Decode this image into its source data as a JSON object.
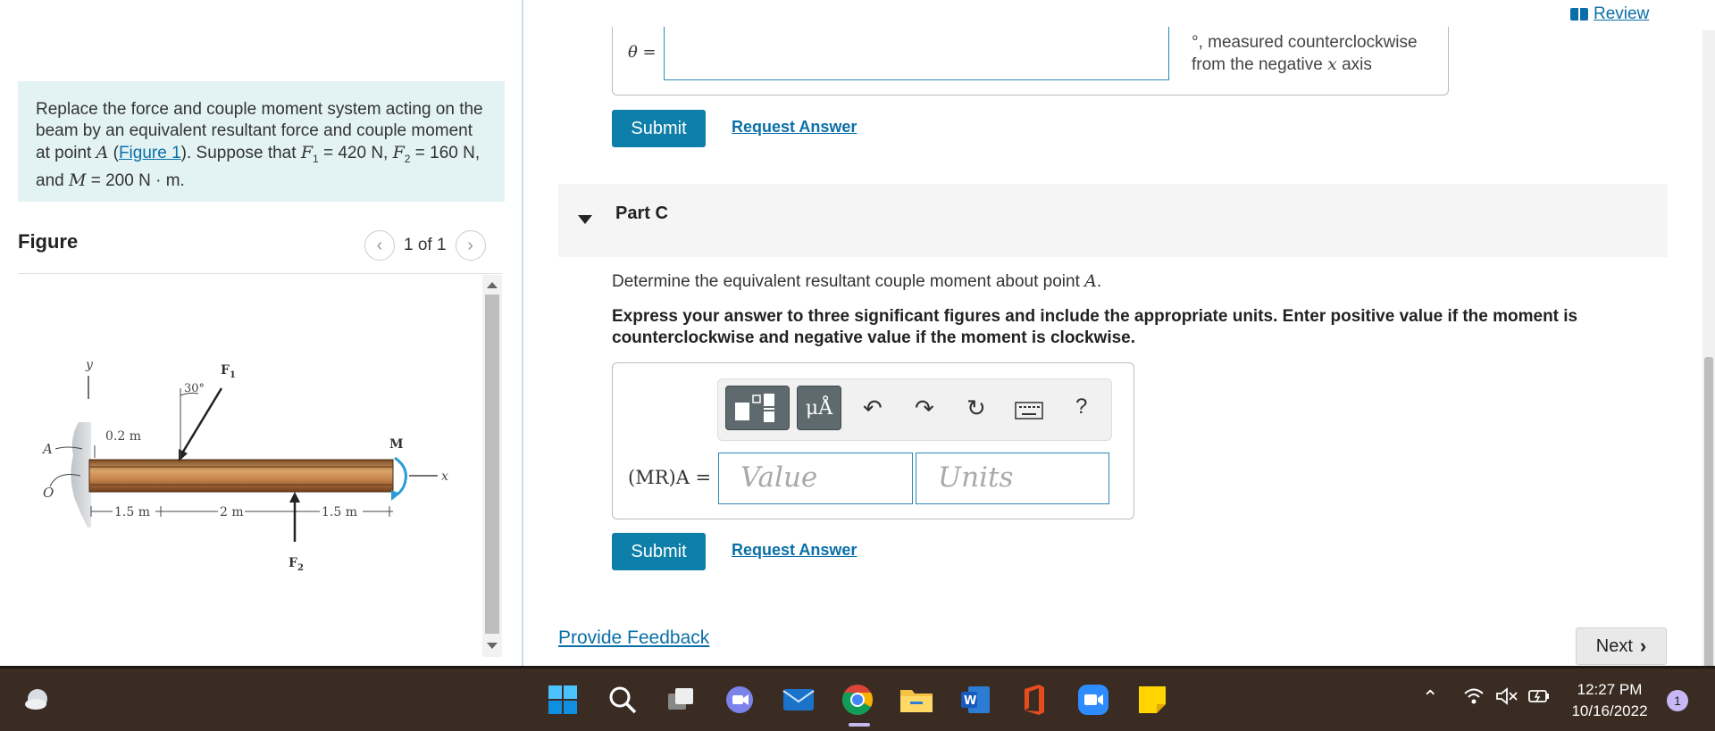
{
  "problem": {
    "text_part1": "Replace the force and couple moment system acting on the beam by an equivalent resultant force and couple moment at point ",
    "point": "A",
    "paren_open": " (",
    "figure_link": "Figure 1",
    "text_part2": "). Suppose that ",
    "f1_var": "F",
    "f1_sub": "1",
    "f1_value": " = 420 N,",
    "f2_var": "F",
    "f2_sub": "2",
    "f2_value": " = 160 N, and ",
    "m_var": "M",
    "m_value": " = 200 N · m."
  },
  "figure": {
    "title": "Figure",
    "pager": "1 of 1",
    "labels": {
      "y": "y",
      "F1": "F",
      "F1_sub": "1",
      "angle": "30°",
      "dim_02": "0.2 m",
      "A": "A",
      "M": "M",
      "x": "x",
      "O": "O",
      "dim_15a": "1.5 m",
      "dim_2": "2 m",
      "dim_15b": "1.5 m",
      "F2": "F",
      "F2_sub": "2"
    }
  },
  "part_b": {
    "theta_label": "θ =",
    "theta_note_line1": "°, measured counterclockwise",
    "theta_note_line2a": "from the negative ",
    "theta_note_var": "x",
    "theta_note_line2b": " axis",
    "submit": "Submit",
    "request": "Request Answer"
  },
  "part_c": {
    "label": "Part C",
    "question_pre": "Determine the equivalent resultant couple moment about point ",
    "question_var": "A",
    "question_post": ".",
    "instruction": "Express your answer to three significant figures and include the appropriate units. Enter positive value if the moment is counterclockwise and negative value if the moment is clockwise.",
    "toolbar_units": "μÅ",
    "help": "?",
    "answer_label": "(MR)A =",
    "value_placeholder": "Value",
    "units_placeholder": "Units",
    "submit": "Submit",
    "request": "Request Answer"
  },
  "footer": {
    "feedback": "Provide Feedback",
    "next": "Next"
  },
  "header": {
    "review": "Review"
  },
  "taskbar": {
    "time": "12:27 PM",
    "date": "10/16/2022",
    "notifications": "1",
    "apps": [
      "start-icon",
      "search-icon",
      "task-view-icon",
      "teams-chat-icon",
      "mail-icon",
      "chrome-icon",
      "file-explorer-icon",
      "word-icon",
      "office-icon",
      "zoom-icon",
      "sticky-notes-icon"
    ],
    "word_letter": "W"
  },
  "colors": {
    "accent": "#0e7fa9",
    "link": "#0a6fa8",
    "problem_bg": "#e3f3f3",
    "taskbar_bg": "#3a2c23"
  }
}
